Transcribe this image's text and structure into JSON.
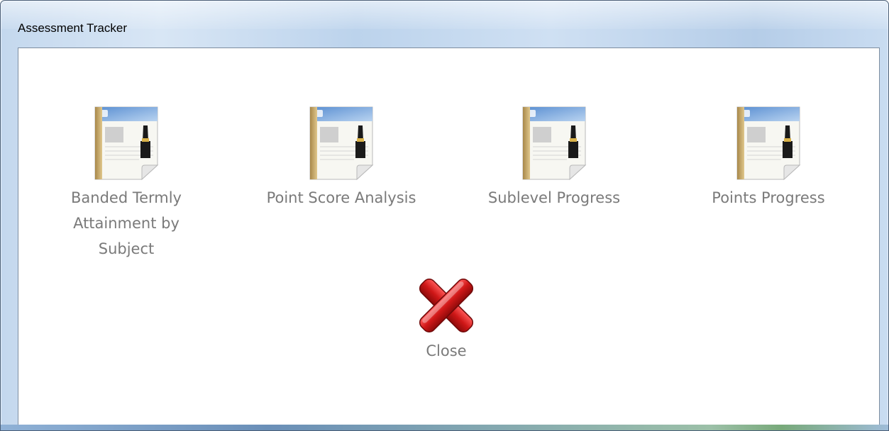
{
  "window": {
    "title": "Assessment Tracker"
  },
  "reports": [
    {
      "label": "Banded Termly Attainment by Subject",
      "icon": "report-document-icon"
    },
    {
      "label": "Point Score Analysis",
      "icon": "report-document-icon"
    },
    {
      "label": "Sublevel Progress",
      "icon": "report-document-icon"
    },
    {
      "label": "Points Progress",
      "icon": "report-document-icon"
    }
  ],
  "close": {
    "label": "Close",
    "icon": "close-x-icon",
    "color": "#d01818"
  }
}
